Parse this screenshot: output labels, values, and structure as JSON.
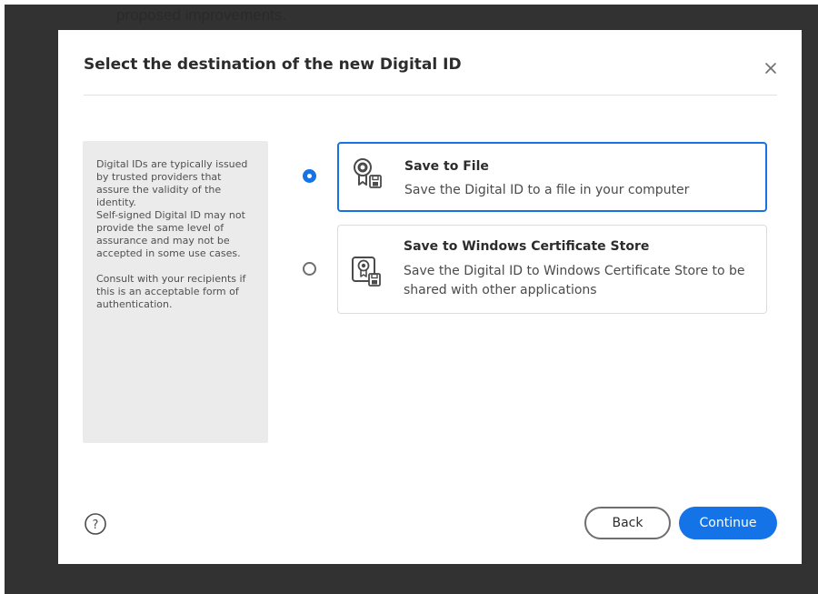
{
  "background_document": {
    "visible_text": "proposed improvements."
  },
  "dialog": {
    "title": "Select the destination of the new Digital ID",
    "info_panel": {
      "paragraph1": "Digital IDs are typically issued by trusted providers that assure the validity of the identity.",
      "paragraph2": "Self-signed Digital ID may not provide the same level of assurance and may not be accepted in some use cases.",
      "paragraph3": "Consult with your recipients if this is an acceptable form of authentication."
    },
    "options": [
      {
        "title": "Save to File",
        "description": "Save the Digital ID to a file in your computer",
        "selected": true,
        "icon": "certificate-file-icon"
      },
      {
        "title": "Save to Windows Certificate Store",
        "description": "Save the Digital ID to Windows Certificate Store to be shared with other applications",
        "selected": false,
        "icon": "certificate-store-icon"
      }
    ],
    "buttons": {
      "back": "Back",
      "continue": "Continue"
    }
  },
  "icons": {
    "close": "close-icon",
    "help": "help-icon"
  },
  "colors": {
    "accent": "#1473e6",
    "backdrop": "#323232",
    "info_panel_bg": "#ebebeb"
  }
}
